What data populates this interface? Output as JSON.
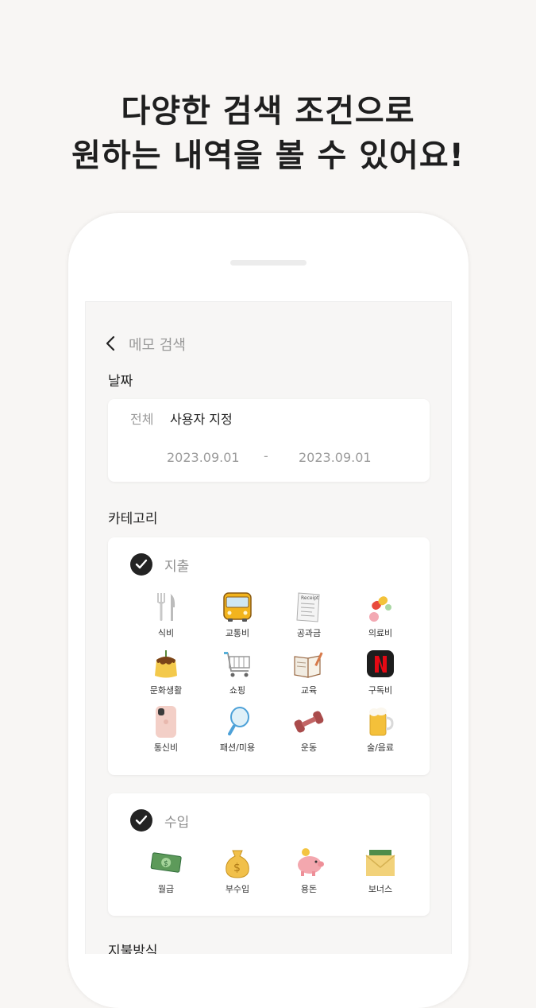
{
  "headline": {
    "line1": "다양한 검색 조건으로",
    "line2": "원하는 내역을 볼 수 있어요!"
  },
  "screen": {
    "title": "메모 검색",
    "date": {
      "label": "날짜",
      "range_all": "전체",
      "range_custom": "사용자 지정",
      "start": "2023.09.01",
      "separator": "-",
      "end": "2023.09.01"
    },
    "category": {
      "label": "카테고리",
      "expense": {
        "name": "지출",
        "items": [
          {
            "label": "식비",
            "icon": "fork-knife-icon"
          },
          {
            "label": "교통비",
            "icon": "bus-icon"
          },
          {
            "label": "공과금",
            "icon": "receipt-icon"
          },
          {
            "label": "의료비",
            "icon": "pill-icon"
          },
          {
            "label": "문화생활",
            "icon": "pudding-icon"
          },
          {
            "label": "쇼핑",
            "icon": "shopping-cart-icon"
          },
          {
            "label": "교육",
            "icon": "book-icon"
          },
          {
            "label": "구독비",
            "icon": "netflix-icon"
          },
          {
            "label": "통신비",
            "icon": "phone-icon"
          },
          {
            "label": "패션/미용",
            "icon": "hand-mirror-icon"
          },
          {
            "label": "운동",
            "icon": "dumbbell-icon"
          },
          {
            "label": "술/음료",
            "icon": "beer-icon"
          }
        ]
      },
      "income": {
        "name": "수입",
        "items": [
          {
            "label": "월급",
            "icon": "banknote-icon"
          },
          {
            "label": "부수입",
            "icon": "money-bag-icon"
          },
          {
            "label": "용돈",
            "icon": "piggy-bank-icon"
          },
          {
            "label": "보너스",
            "icon": "money-envelope-icon"
          }
        ]
      }
    },
    "payment": {
      "label": "지불방식"
    }
  }
}
